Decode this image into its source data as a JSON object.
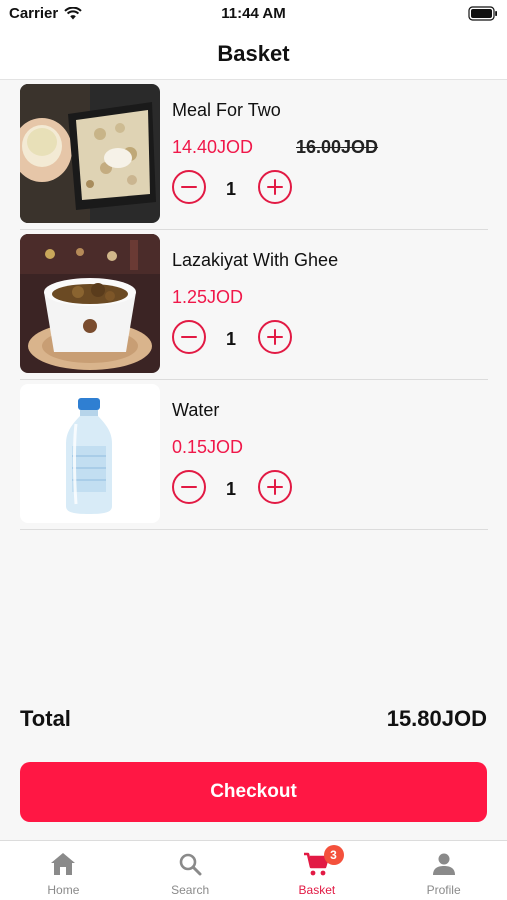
{
  "status": {
    "carrier": "Carrier",
    "time": "11:44 AM"
  },
  "header": {
    "title": "Basket"
  },
  "items": [
    {
      "name": "Meal For Two",
      "price": "14.40JOD",
      "old_price": "16.00JOD",
      "quantity": "1",
      "image": "food-photo-rice-dish"
    },
    {
      "name": "Lazakiyat With Ghee",
      "price": "1.25JOD",
      "quantity": "1",
      "image": "food-photo-bowl"
    },
    {
      "name": "Water",
      "price": "0.15JOD",
      "quantity": "1",
      "image": "water-bottle-photo"
    }
  ],
  "total": {
    "label": "Total",
    "value": "15.80JOD"
  },
  "checkout": {
    "label": "Checkout"
  },
  "tabbar": {
    "tabs": [
      {
        "label": "Home",
        "icon": "home-icon"
      },
      {
        "label": "Search",
        "icon": "search-icon"
      },
      {
        "label": "Basket",
        "icon": "cart-icon",
        "badge": "3",
        "active": true
      },
      {
        "label": "Profile",
        "icon": "person-icon"
      }
    ]
  },
  "colors": {
    "accent": "#ff1744",
    "price": "#f0184a",
    "badge": "#f4513c",
    "inactive": "#8a8a8a"
  }
}
